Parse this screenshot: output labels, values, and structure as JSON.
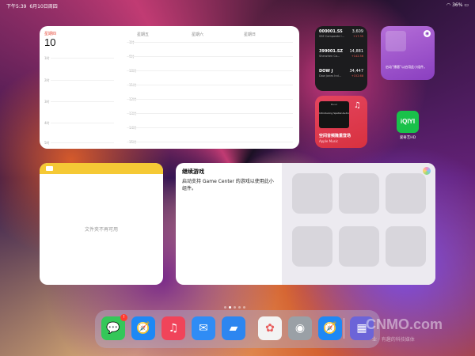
{
  "status_bar": {
    "time": "下午5:39",
    "date": "6月10日周四",
    "battery": "36%"
  },
  "calendar": {
    "weekday": "星期四",
    "day": "10",
    "columns": [
      "星期五",
      "星期六",
      "星期日"
    ],
    "hours_left": [
      "1时",
      "2时",
      "3时",
      "4时",
      "5时"
    ],
    "hours_right": [
      "1时",
      "9时",
      "10时",
      "11时",
      "12时",
      "13时",
      "14时",
      "15时"
    ]
  },
  "stocks": [
    {
      "symbol": "000001.SS",
      "name": "SSE Composite I...",
      "price": "3,609",
      "change": "+17.35",
      "trend": "up"
    },
    {
      "symbol": "399001.SZ",
      "name": "Shenzhen Co...",
      "price": "14,881",
      "change": "+142.56",
      "trend": "up"
    },
    {
      "symbol": "DOW J",
      "name": "Dow Jones Ind...",
      "price": "34,447",
      "change": "+152.68",
      "trend": "up"
    }
  ],
  "podcasts": {
    "text": "启动“播客”以启用此小组件。"
  },
  "music": {
    "album_brand": "Music",
    "album_title": "Introducing Spatial Audio",
    "title": "空间音频隆重登场",
    "subtitle": "Apple Music"
  },
  "iqiyi": {
    "icon_text": "iQIYI",
    "label": "爱奇艺HD"
  },
  "notes": {
    "empty_text": "文件夹不再可用"
  },
  "game_center": {
    "title": "继续游戏",
    "description": "启动支持 Game Center 的游戏以使用此小组件。"
  },
  "dock": {
    "apps": [
      {
        "name": "messages",
        "glyph": "💬",
        "color": "#34c759",
        "badge": "!"
      },
      {
        "name": "safari",
        "glyph": "🧭",
        "color": "#1e88f5"
      },
      {
        "name": "music",
        "glyph": "♫",
        "color": "#f0445a"
      },
      {
        "name": "mail",
        "glyph": "✉",
        "color": "#2f8cf5"
      },
      {
        "name": "files",
        "glyph": "▰",
        "color": "#2d86f0"
      },
      {
        "name": "photos",
        "glyph": "✿",
        "color": "#f3f3f3"
      },
      {
        "name": "camera",
        "glyph": "◉",
        "color": "#9aa0a6"
      },
      {
        "name": "safari-recent",
        "glyph": "🧭",
        "color": "#1e88f5"
      },
      {
        "name": "app-library",
        "glyph": "▦",
        "color": "#6c64d8"
      }
    ]
  },
  "watermark": {
    "text": "CNMO.com",
    "sub": "业 · 有趣的科技媒体"
  }
}
